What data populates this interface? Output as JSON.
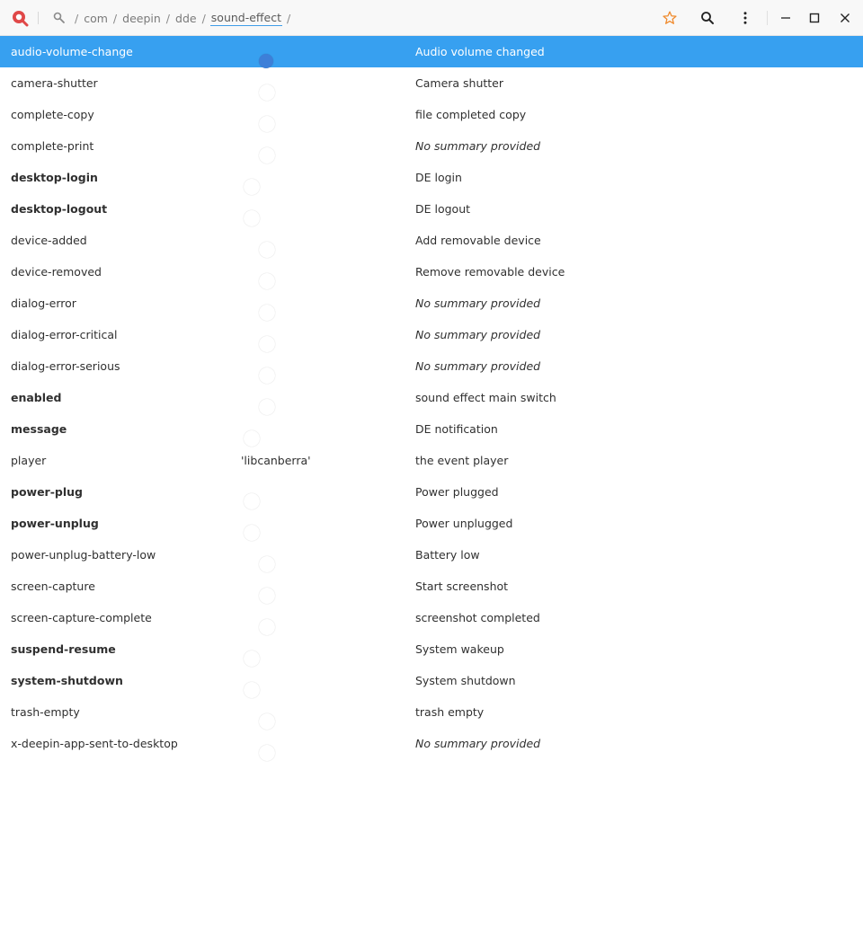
{
  "breadcrumb": {
    "segments": [
      "/",
      "com",
      "/",
      "deepin",
      "/",
      "dde",
      "/",
      "sound-effect",
      "/"
    ]
  },
  "colors": {
    "accent": "#37a0f0",
    "toggle_on": "#3aa0ef",
    "toggle_off": "#dcdde3",
    "star": "#f08a2c",
    "logo": "#e04848"
  },
  "rows": [
    {
      "key": "audio-volume-change",
      "bold": false,
      "type": "toggle",
      "on": true,
      "desc": "Audio volume changed",
      "italic": false,
      "selected": true
    },
    {
      "key": "camera-shutter",
      "bold": false,
      "type": "toggle",
      "on": true,
      "desc": "Camera shutter",
      "italic": false
    },
    {
      "key": "complete-copy",
      "bold": false,
      "type": "toggle",
      "on": true,
      "desc": "file completed copy",
      "italic": false
    },
    {
      "key": "complete-print",
      "bold": false,
      "type": "toggle",
      "on": true,
      "desc": "No summary provided",
      "italic": true
    },
    {
      "key": "desktop-login",
      "bold": true,
      "type": "toggle",
      "on": false,
      "desc": "DE login",
      "italic": false
    },
    {
      "key": "desktop-logout",
      "bold": true,
      "type": "toggle",
      "on": false,
      "desc": "DE logout",
      "italic": false
    },
    {
      "key": "device-added",
      "bold": false,
      "type": "toggle",
      "on": true,
      "desc": "Add removable device",
      "italic": false
    },
    {
      "key": "device-removed",
      "bold": false,
      "type": "toggle",
      "on": true,
      "desc": "Remove removable device",
      "italic": false
    },
    {
      "key": "dialog-error",
      "bold": false,
      "type": "toggle",
      "on": true,
      "desc": "No summary provided",
      "italic": true
    },
    {
      "key": "dialog-error-critical",
      "bold": false,
      "type": "toggle",
      "on": true,
      "desc": "No summary provided",
      "italic": true
    },
    {
      "key": "dialog-error-serious",
      "bold": false,
      "type": "toggle",
      "on": true,
      "desc": "No summary provided",
      "italic": true
    },
    {
      "key": "enabled",
      "bold": true,
      "type": "toggle",
      "on": true,
      "desc": "sound effect main switch",
      "italic": false
    },
    {
      "key": "message",
      "bold": true,
      "type": "toggle",
      "on": false,
      "desc": "DE notification",
      "italic": false
    },
    {
      "key": "player",
      "bold": false,
      "type": "text",
      "value": "'libcanberra'",
      "desc": "the event player",
      "italic": false
    },
    {
      "key": "power-plug",
      "bold": true,
      "type": "toggle",
      "on": false,
      "desc": "Power plugged",
      "italic": false
    },
    {
      "key": "power-unplug",
      "bold": true,
      "type": "toggle",
      "on": false,
      "desc": "Power unplugged",
      "italic": false
    },
    {
      "key": "power-unplug-battery-low",
      "bold": false,
      "type": "toggle",
      "on": true,
      "desc": "Battery low",
      "italic": false
    },
    {
      "key": "screen-capture",
      "bold": false,
      "type": "toggle",
      "on": true,
      "desc": "Start screenshot",
      "italic": false
    },
    {
      "key": "screen-capture-complete",
      "bold": false,
      "type": "toggle",
      "on": true,
      "desc": "screenshot completed",
      "italic": false
    },
    {
      "key": "suspend-resume",
      "bold": true,
      "type": "toggle",
      "on": false,
      "desc": "System wakeup",
      "italic": false
    },
    {
      "key": "system-shutdown",
      "bold": true,
      "type": "toggle",
      "on": false,
      "desc": "System shutdown",
      "italic": false
    },
    {
      "key": "trash-empty",
      "bold": false,
      "type": "toggle",
      "on": true,
      "desc": "trash empty",
      "italic": false
    },
    {
      "key": "x-deepin-app-sent-to-desktop",
      "bold": false,
      "type": "toggle",
      "on": true,
      "desc": "No summary provided",
      "italic": true
    }
  ]
}
